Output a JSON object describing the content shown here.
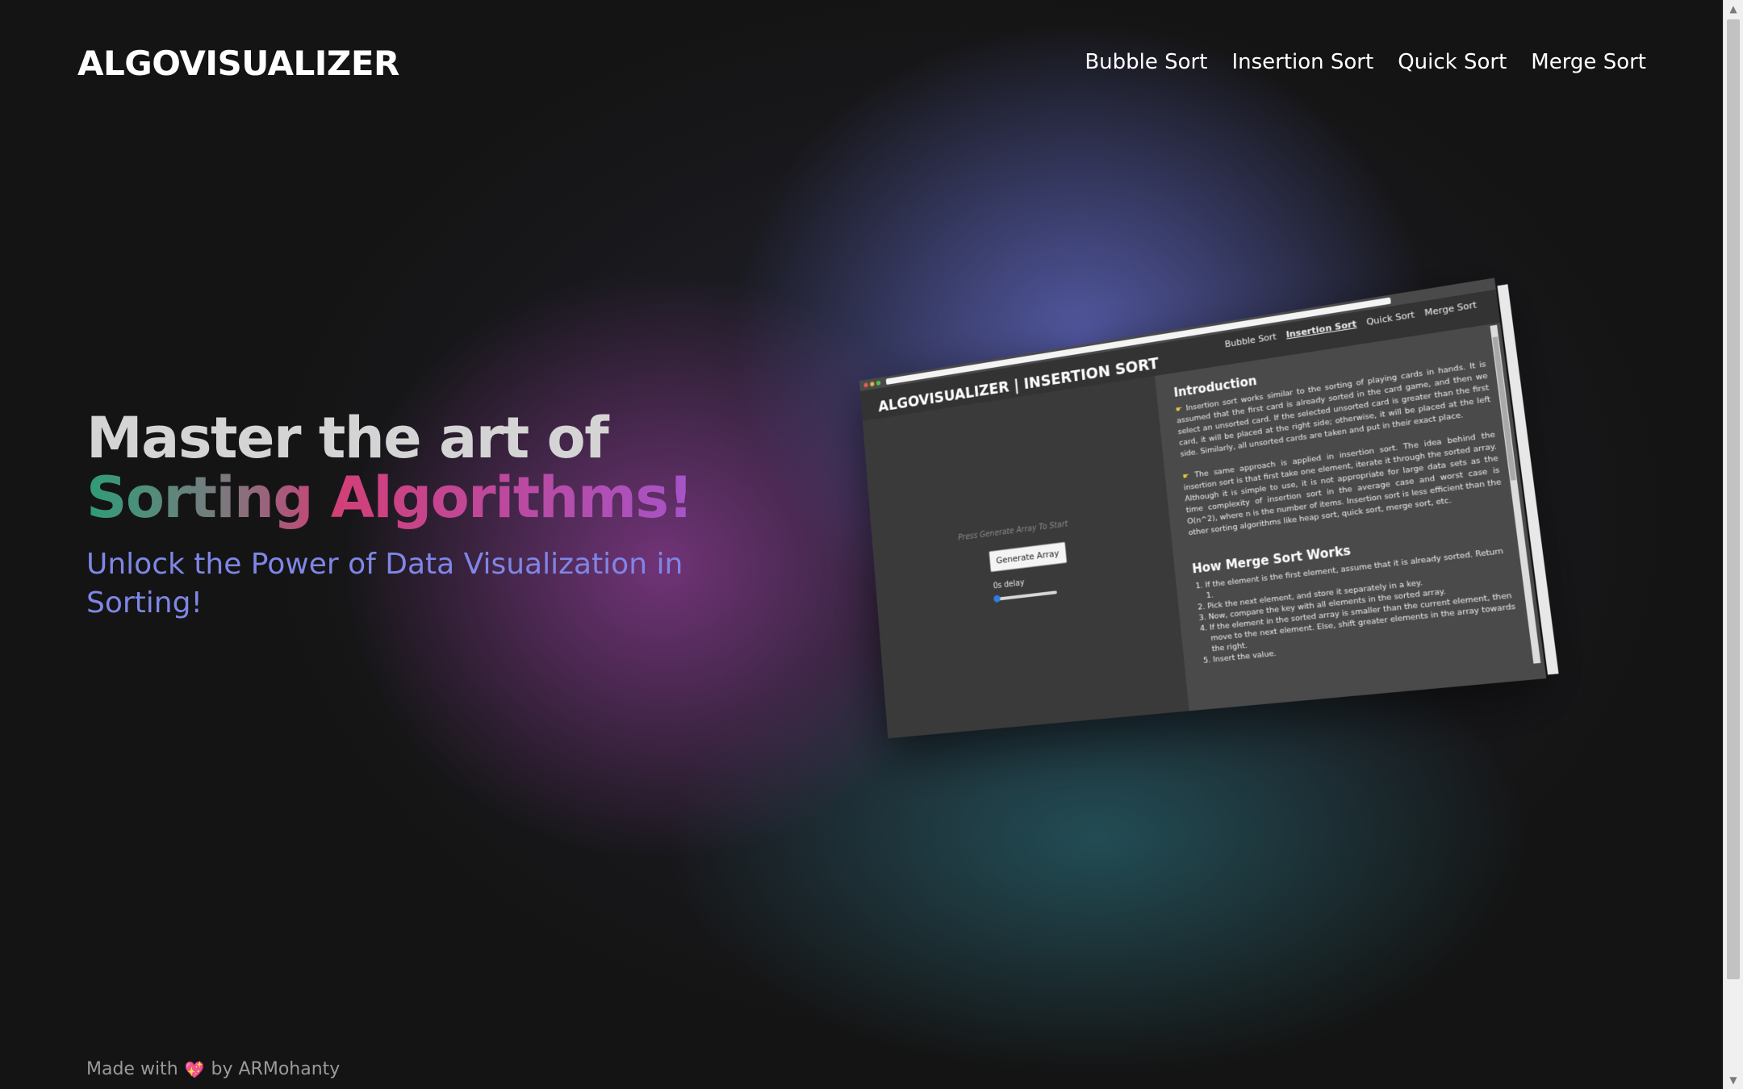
{
  "header": {
    "logo": "ALGOVISUALIZER",
    "nav": [
      "Bubble Sort",
      "Insertion Sort",
      "Quick Sort",
      "Merge Sort"
    ]
  },
  "hero": {
    "line1": "Master the art of",
    "line2_a": "Sorting",
    "line2_b": "Algorithms!",
    "subtitle": "Unlock the Power of Data Visualization in Sorting!"
  },
  "footer": {
    "prefix": "Made with",
    "heart": "💖",
    "suffix": "by ARMohanty"
  },
  "preview": {
    "title": "ALGOVISUALIZER | INSERTION SORT",
    "nav": [
      "Bubble Sort",
      "Insertion Sort",
      "Quick Sort",
      "Merge Sort"
    ],
    "active_nav": "Insertion Sort",
    "hint": "Press Generate Array To Start",
    "generate_button": "Generate Array",
    "delay_label": "0s delay",
    "delay_value": 0,
    "intro_heading": "Introduction",
    "intro_p1": "Insertion sort works similar to the sorting of playing cards in hands. It is assumed that the first card is already sorted in the card game, and then we select an unsorted card. If the selected unsorted card is greater than the first card, it will be placed at the right side; otherwise, it will be placed at the left side. Similarly, all unsorted cards are taken and put in their exact place.",
    "intro_p2": "The same approach is applied in insertion sort. The idea behind the insertion sort is that first take one element, iterate it through the sorted array. Although it is simple to use, it is not appropriate for large data sets as the time complexity of insertion sort in the average case and worst case is O(n^2), where n is the number of items. Insertion sort is less efficient than the other sorting algorithms like heap sort, quick sort, merge sort, etc.",
    "how_heading": "How Merge Sort Works",
    "steps": [
      "If the element is the first element, assume that it is already sorted. Return 1.",
      "Pick the next element, and store it separately in a key.",
      "Now, compare the key with all elements in the sorted array.",
      "If the element in the sorted array is smaller than the current element, then move to the next element. Else, shift greater elements in the array towards the right.",
      "Insert the value."
    ]
  }
}
